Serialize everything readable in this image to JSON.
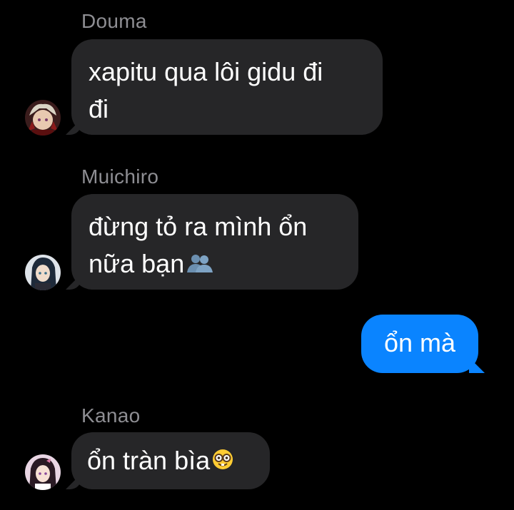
{
  "messages": [
    {
      "sender": "Douma",
      "lines": [
        "xapitu qua lôi gidu đi",
        "đi"
      ],
      "avatar": "douma-avatar"
    },
    {
      "sender": "Muichiro",
      "lines": [
        "đừng tỏ ra mình ổn",
        "nữa bạn"
      ],
      "emoji": "busts-in-silhouette",
      "avatar": "muichiro-avatar"
    },
    {
      "outgoing": true,
      "lines": [
        "ổn mà"
      ]
    },
    {
      "sender": "Kanao",
      "lines": [
        "ổn tràn bìa"
      ],
      "emoji": "nerd-face",
      "avatar": "kanao-avatar"
    }
  ],
  "colors": {
    "background": "#000000",
    "incoming_bubble": "#262628",
    "outgoing_bubble": "#0a84ff",
    "sender_name": "#8e8e93"
  }
}
